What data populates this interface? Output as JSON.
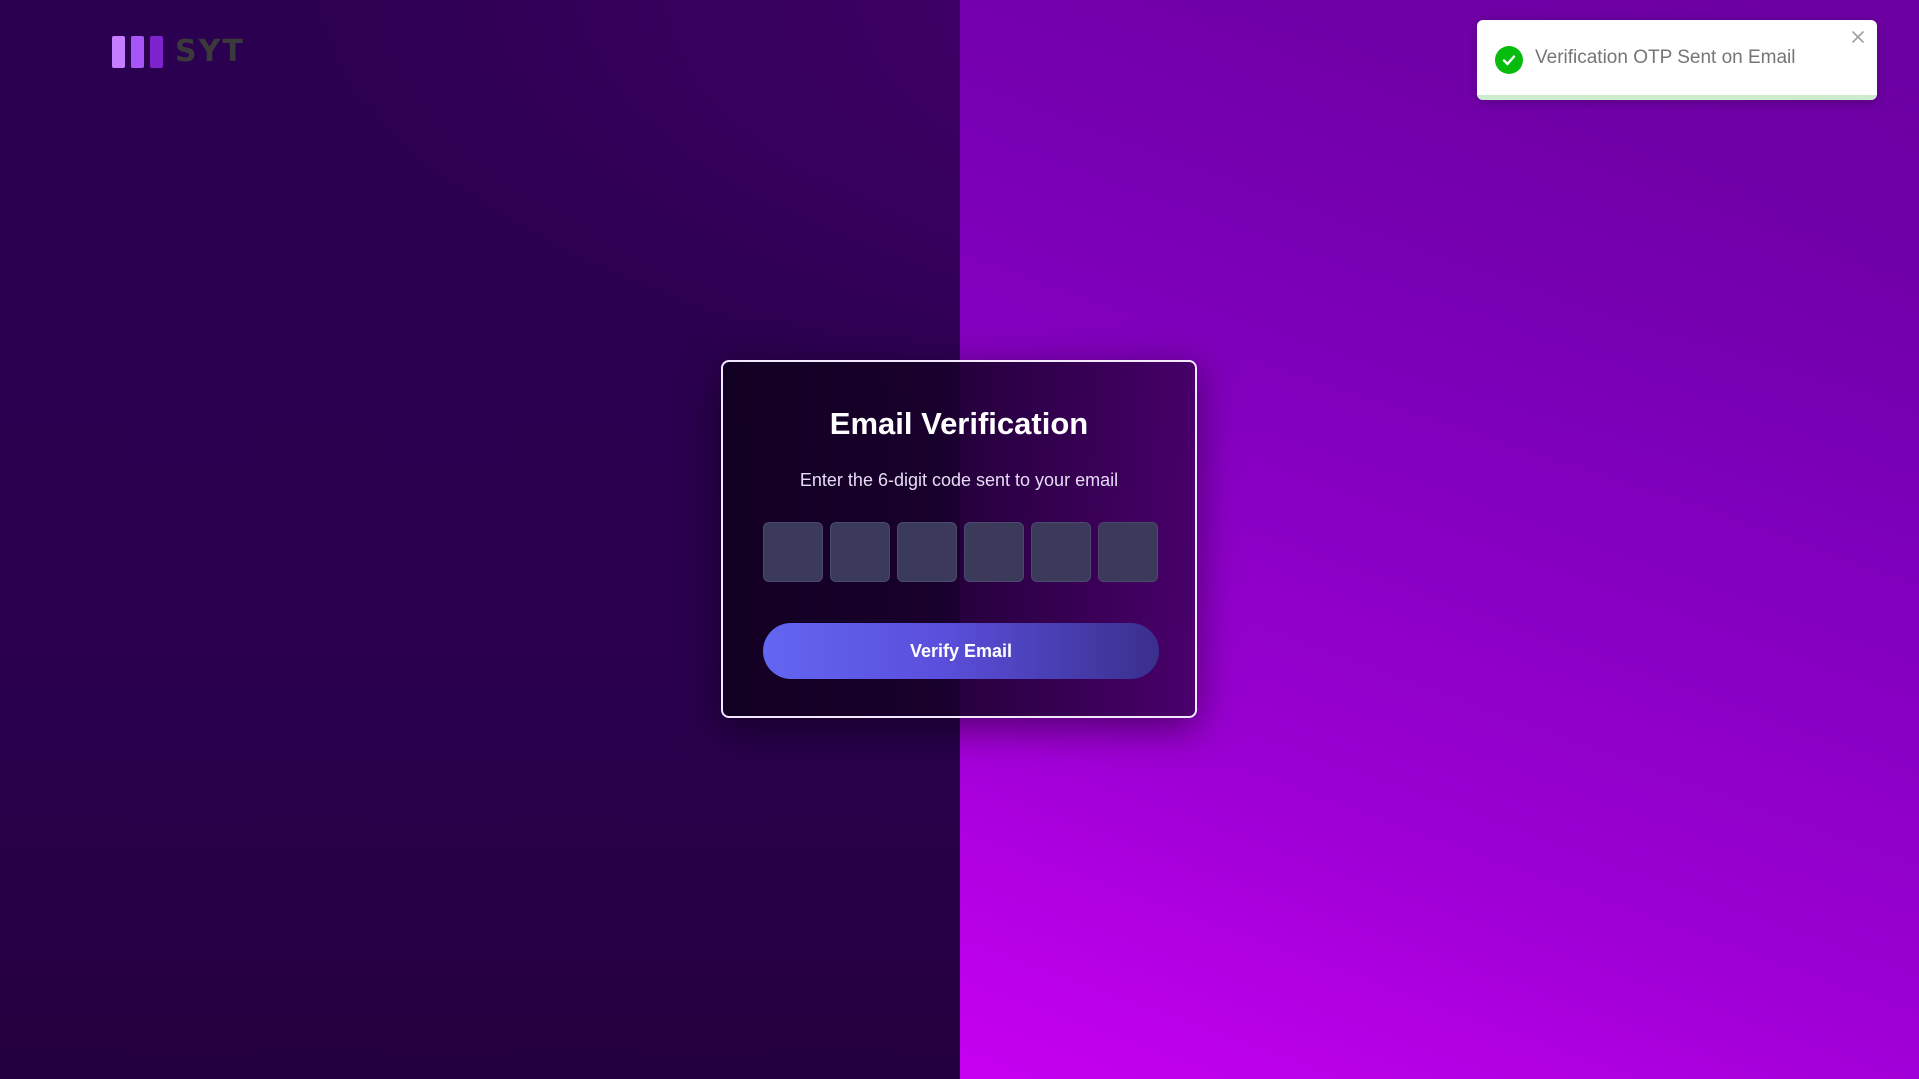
{
  "brand": {
    "name": "SYT"
  },
  "verification": {
    "title": "Email Verification",
    "subtitle": "Enter the 6-digit code sent to your email",
    "otp_digits": [
      "",
      "",
      "",
      "",
      "",
      ""
    ],
    "verify_label": "Verify Email"
  },
  "toast": {
    "message": "Verification OTP Sent on Email",
    "icon": "check-circle-icon",
    "close_icon": "close-icon",
    "status_color": "#07bc0c"
  },
  "colors": {
    "accent": "#6366f1",
    "background_left": "#2a004d",
    "background_right": "#9a00d2"
  }
}
